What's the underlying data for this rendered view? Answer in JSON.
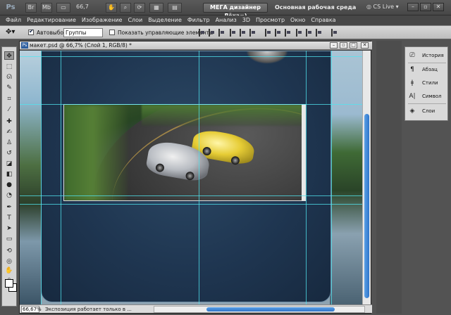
{
  "app": {
    "logo": "Ps",
    "zoom_value": "66,7",
    "brand_button": "МЕГА дизайнер Лёха=)",
    "workspace": "Основная рабочая среда",
    "cs_live": "CS Live",
    "icons": [
      "bridge-icon",
      "mini-bridge-icon",
      "screen-mode-icon",
      "hand-icon",
      "zoom-tool-icon",
      "rotate-view-icon",
      "arrange-docs-icon"
    ]
  },
  "menu": [
    "Файл",
    "Редактирование",
    "Изображение",
    "Слои",
    "Выделение",
    "Фильтр",
    "Анализ",
    "3D",
    "Просмотр",
    "Окно",
    "Справка"
  ],
  "options": {
    "autoselect_label": "Автовыбор:",
    "autoselect_checked": true,
    "autoselect_value": "Группы слоев",
    "show_controls_label": "Показать управляющие элементы",
    "show_controls_checked": false
  },
  "tools": [
    "move-tool",
    "marquee-tool",
    "lasso-tool",
    "quick-select-tool",
    "crop-tool",
    "eyedropper-tool",
    "healing-tool",
    "brush-tool",
    "clone-stamp-tool",
    "history-brush-tool",
    "eraser-tool",
    "gradient-tool",
    "blur-tool",
    "dodge-tool",
    "pen-tool",
    "type-tool",
    "path-select-tool",
    "shape-tool",
    "3d-rotate-tool",
    "3d-orbit-tool",
    "hand-tool",
    "zoom-tool"
  ],
  "document": {
    "title": "макет.psd @ 66,7% (Слой 1, RGB/8) *",
    "zoom": "66,67%",
    "status": "Экспозиция работает только в ..."
  },
  "panels": [
    {
      "label": "История",
      "icon": "history-icon"
    },
    {
      "label": "Абзац",
      "icon": "paragraph-icon"
    },
    {
      "label": "Стили",
      "icon": "styles-icon"
    },
    {
      "label": "Символ",
      "icon": "character-icon"
    },
    {
      "label": "Слои",
      "icon": "layers-icon"
    }
  ],
  "colors": {
    "guide": "#50e6f0",
    "accent": "#2f74c9"
  }
}
